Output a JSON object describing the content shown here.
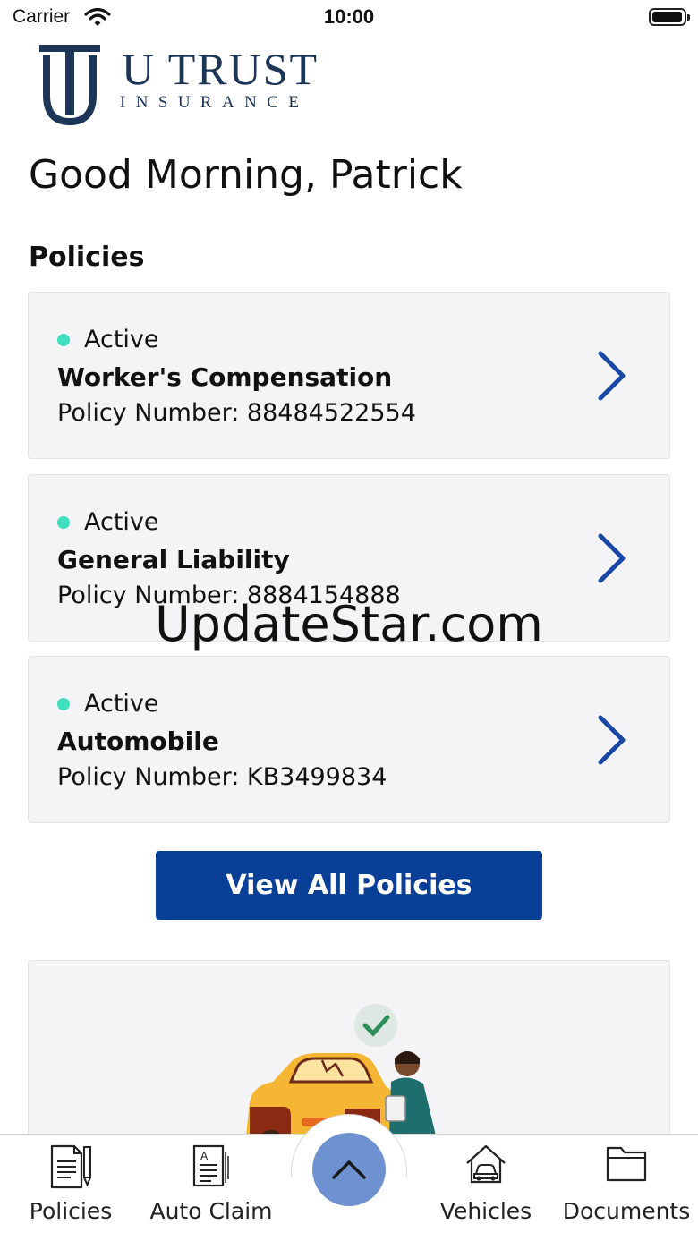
{
  "status_bar": {
    "carrier": "Carrier",
    "time": "10:00"
  },
  "logo": {
    "name": "U TRUST",
    "subtitle": "INSURANCE"
  },
  "greeting": "Good Morning, Patrick",
  "policies_section": {
    "title": "Policies"
  },
  "policies": [
    {
      "status": "Active",
      "name": "Worker's Compensation",
      "number_text": "Policy Number: 88484522554"
    },
    {
      "status": "Active",
      "name": "General Liability",
      "number_text": "Policy Number: 8884154888"
    },
    {
      "status": "Active",
      "name": "Automobile",
      "number_text": "Policy Number: KB3499834"
    }
  ],
  "view_all_label": "View All Policies",
  "watermark": "UpdateStar.com",
  "tab_bar": {
    "items": [
      {
        "label": "Policies",
        "icon": "policies-icon"
      },
      {
        "label": "Auto Claim",
        "icon": "auto-claim-icon"
      },
      {
        "label": "Vehicles",
        "icon": "vehicles-icon"
      },
      {
        "label": "Documents",
        "icon": "documents-icon"
      }
    ],
    "center_icon": "chevron-up-icon"
  },
  "colors": {
    "brand_navy": "#1d3557",
    "primary_button": "#0a3f98",
    "active_dot": "#3ee0bf",
    "chevron": "#1847a6",
    "fab": "#6e92d0",
    "card_bg": "#f4f4f6"
  }
}
